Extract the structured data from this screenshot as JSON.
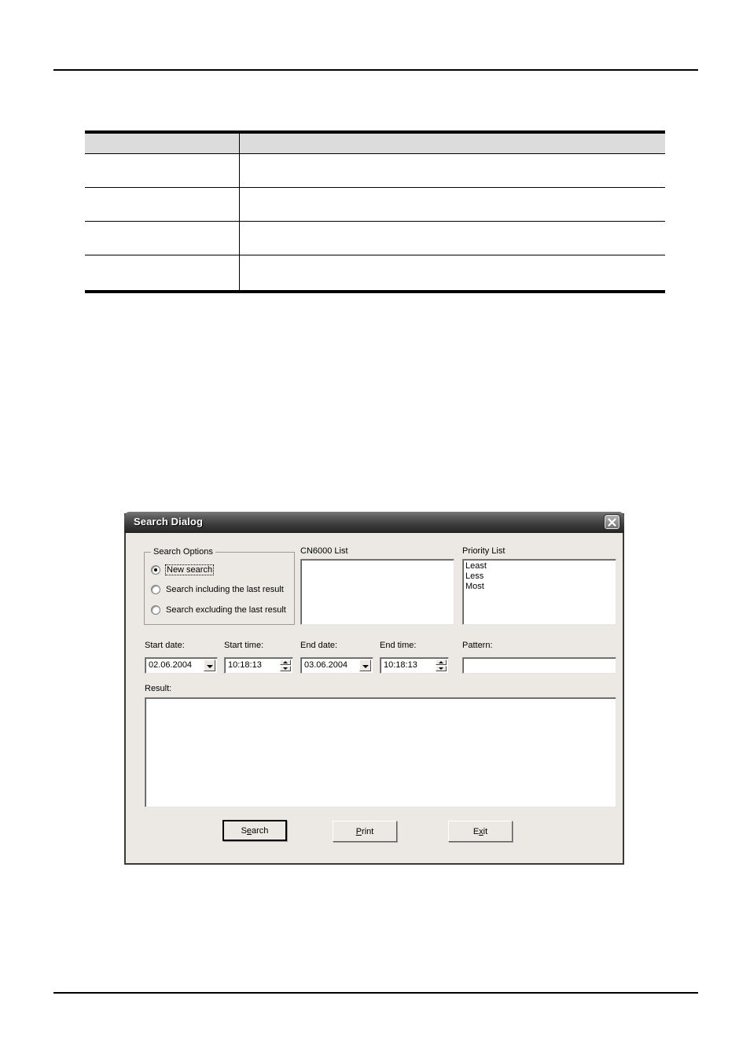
{
  "page": {
    "top_rule": true,
    "bottom_rule": true
  },
  "reference_table": {
    "columns": [
      "",
      ""
    ],
    "rows": [
      [
        "",
        ""
      ],
      [
        "",
        ""
      ],
      [
        "",
        ""
      ],
      [
        "",
        ""
      ]
    ]
  },
  "dialog": {
    "title": "Search Dialog",
    "close_icon": "close-icon",
    "search_options": {
      "legend": "Search Options",
      "options": [
        {
          "label": "New search",
          "selected": true,
          "focused": true
        },
        {
          "label": "Search including the last result",
          "selected": false,
          "focused": false
        },
        {
          "label": "Search excluding the last result",
          "selected": false,
          "focused": false
        }
      ]
    },
    "cn6000_list": {
      "label": "CN6000 List",
      "items": []
    },
    "priority_list": {
      "label": "Priority List",
      "items": [
        "Least",
        "Less",
        "Most"
      ]
    },
    "fields": {
      "start_date": {
        "label": "Start date:",
        "value": "02.06.2004"
      },
      "start_time": {
        "label": "Start time:",
        "value": "10:18:13"
      },
      "end_date": {
        "label": "End date:",
        "value": "03.06.2004"
      },
      "end_time": {
        "label": "End time:",
        "value": "10:18:13"
      },
      "pattern": {
        "label": "Pattern:",
        "value": "",
        "placeholder": ""
      }
    },
    "result": {
      "label": "Result:",
      "value": ""
    },
    "buttons": [
      {
        "name": "search",
        "label_pre": "S",
        "label_acc": "e",
        "label_post": "arch",
        "default": true
      },
      {
        "name": "print",
        "label_pre": "",
        "label_acc": "P",
        "label_post": "rint",
        "default": false
      },
      {
        "name": "exit",
        "label_pre": "E",
        "label_acc": "x",
        "label_post": "it",
        "default": false
      }
    ]
  },
  "colors": {
    "dialog_face": "#ece9e4",
    "titlebar_dark": "#232323",
    "table_header": "#dcdcdc",
    "field_white": "#ffffff"
  }
}
